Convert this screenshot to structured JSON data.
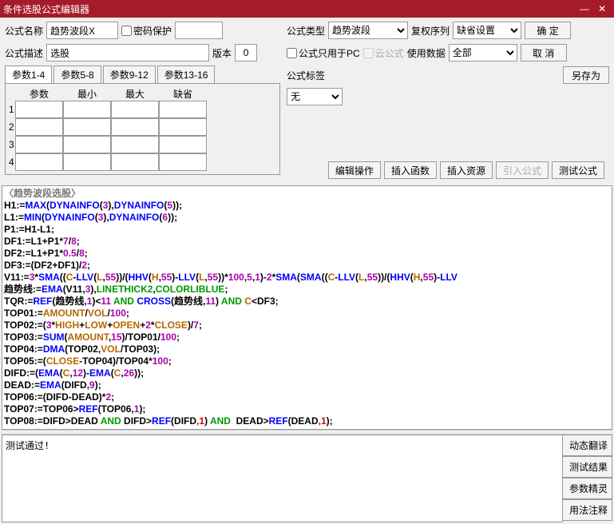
{
  "title": "条件选股公式编辑器",
  "form": {
    "name_label": "公式名称",
    "name_value": "趋势波段X",
    "password_protect": "密码保护",
    "desc_label": "公式描述",
    "desc_value": "选股",
    "version_label": "版本",
    "version_value": "0",
    "type_label": "公式类型",
    "type_value": "趋势波段",
    "fuquan_label": "复权序列",
    "fuquan_value": "缺省设置",
    "only_pc": "公式只用于PC",
    "cloud": "云公式",
    "use_data_label": "使用数据",
    "use_data_value": "全部",
    "tag_label": "公式标签",
    "tag_value": "无"
  },
  "param_tabs": [
    "参数1-4",
    "参数5-8",
    "参数9-12",
    "参数13-16"
  ],
  "param_headers": [
    "参数",
    "最小",
    "最大",
    "缺省"
  ],
  "toolbar": {
    "edit_op": "编辑操作",
    "insert_func": "插入函数",
    "insert_res": "插入资源",
    "import_formula": "引入公式",
    "test_formula": "测试公式"
  },
  "buttons": {
    "ok": "确 定",
    "cancel": "取 消",
    "save_as": "另存为"
  },
  "editor_title": "〈趋势波段选股〉",
  "output_text": "测试通过!",
  "sidebtns": [
    "动态翻译",
    "测试结果",
    "参数精灵",
    "用法注释"
  ]
}
